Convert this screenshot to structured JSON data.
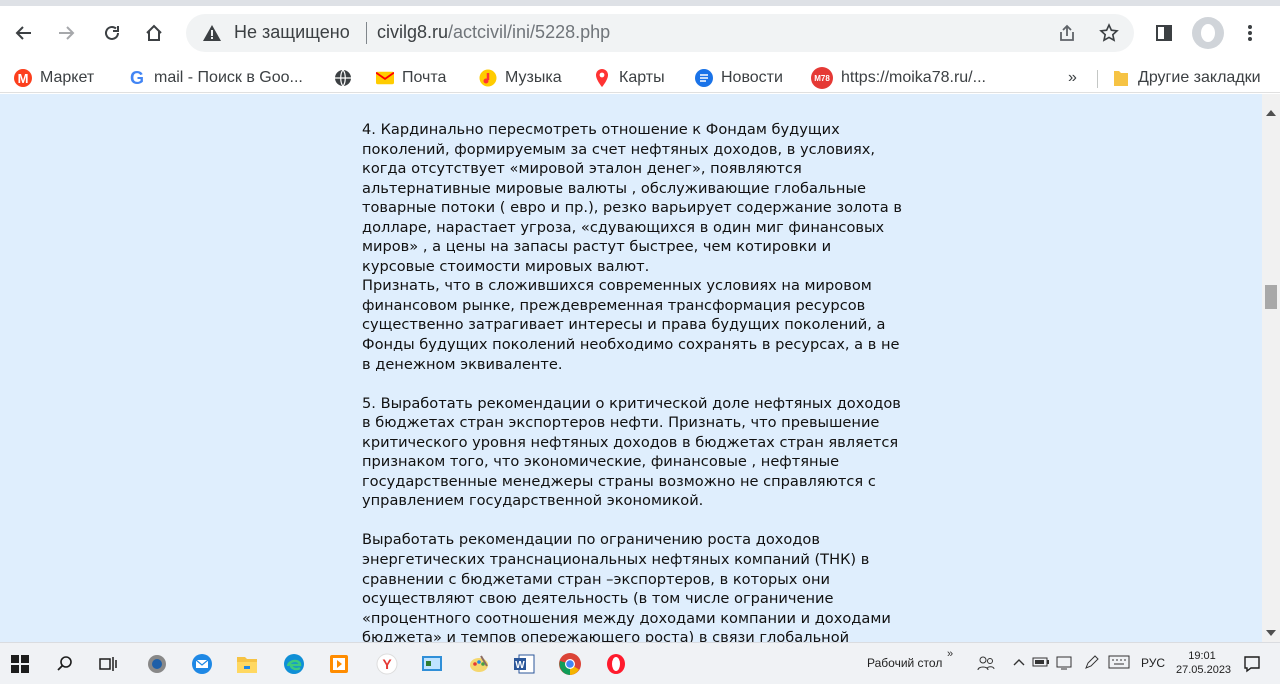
{
  "browser": {
    "not_secure_label": "Не защищено",
    "url_domain": "civilg8.ru",
    "url_path": "/actcivil/ini/5228.php"
  },
  "bookmarks": [
    {
      "label": "Маркет",
      "icon": "yandex-market-icon"
    },
    {
      "label": "mail - Поиск в Goo...",
      "icon": "google-icon"
    },
    {
      "label": "",
      "icon": "globe-icon"
    },
    {
      "label": "Почта",
      "icon": "mail-icon"
    },
    {
      "label": "Музыка",
      "icon": "music-icon"
    },
    {
      "label": "Карты",
      "icon": "maps-pin-icon"
    },
    {
      "label": "Новости",
      "icon": "news-icon"
    },
    {
      "label": "https://moika78.ru/...",
      "icon": "m78-icon",
      "badge": "M78"
    }
  ],
  "bookmarks_more": "»",
  "other_bookmarks": "Другие закладки",
  "article": {
    "p1": "4. Кардинально пересмотреть отношение к Фондам будущих поколений, формируемым за счет нефтяных доходов, в условиях, когда отсутствует «мировой эталон денег», появляются альтернативные мировые валюты , обслуживающие глобальные товарные потоки ( евро и пр.), резко варьирует содержание золота в долларе, нарастает угроза, «сдувающихся в один миг финансовых миров» , а цены на запасы растут быстрее, чем котировки и курсовые стоимости мировых валют.",
    "p2": "Признать, что в сложившихся современных условиях на мировом финансовом рынке, преждевременная трансформация ресурсов существенно затрагивает интересы и права будущих поколений, а Фонды будущих поколений необходимо сохранять в ресурсах, а в не в денежном эквиваленте.",
    "p3": "5. Выработать рекомендации о критической доле нефтяных доходов в бюджетах стран экспортеров нефти. Признать, что превышение критического уровня нефтяных доходов в бюджетах стран является признаком того, что экономические, финансовые , нефтяные государственные менеджеры страны возможно не справляются с управлением государственной экономикой.",
    "p4": "Выработать рекомендации по ограничению роста доходов энергетических транснациональных нефтяных компаний (ТНК) в сравнении с бюджетами стран –экспортеров, в которых они осуществляют свою деятельность (в том числе ограничение «процентного соотношения между доходами компании и доходами бюджета» и темпов опережающего роста) в связи глобальной угрозой"
  },
  "taskbar": {
    "desktop_label": "Рабочий стол",
    "desktop_chevron": "»",
    "lang": "РУС",
    "time": "19:01",
    "date": "27.05.2023"
  },
  "colors": {
    "page_background": "#dfeefd",
    "warning": "#3c4043"
  }
}
